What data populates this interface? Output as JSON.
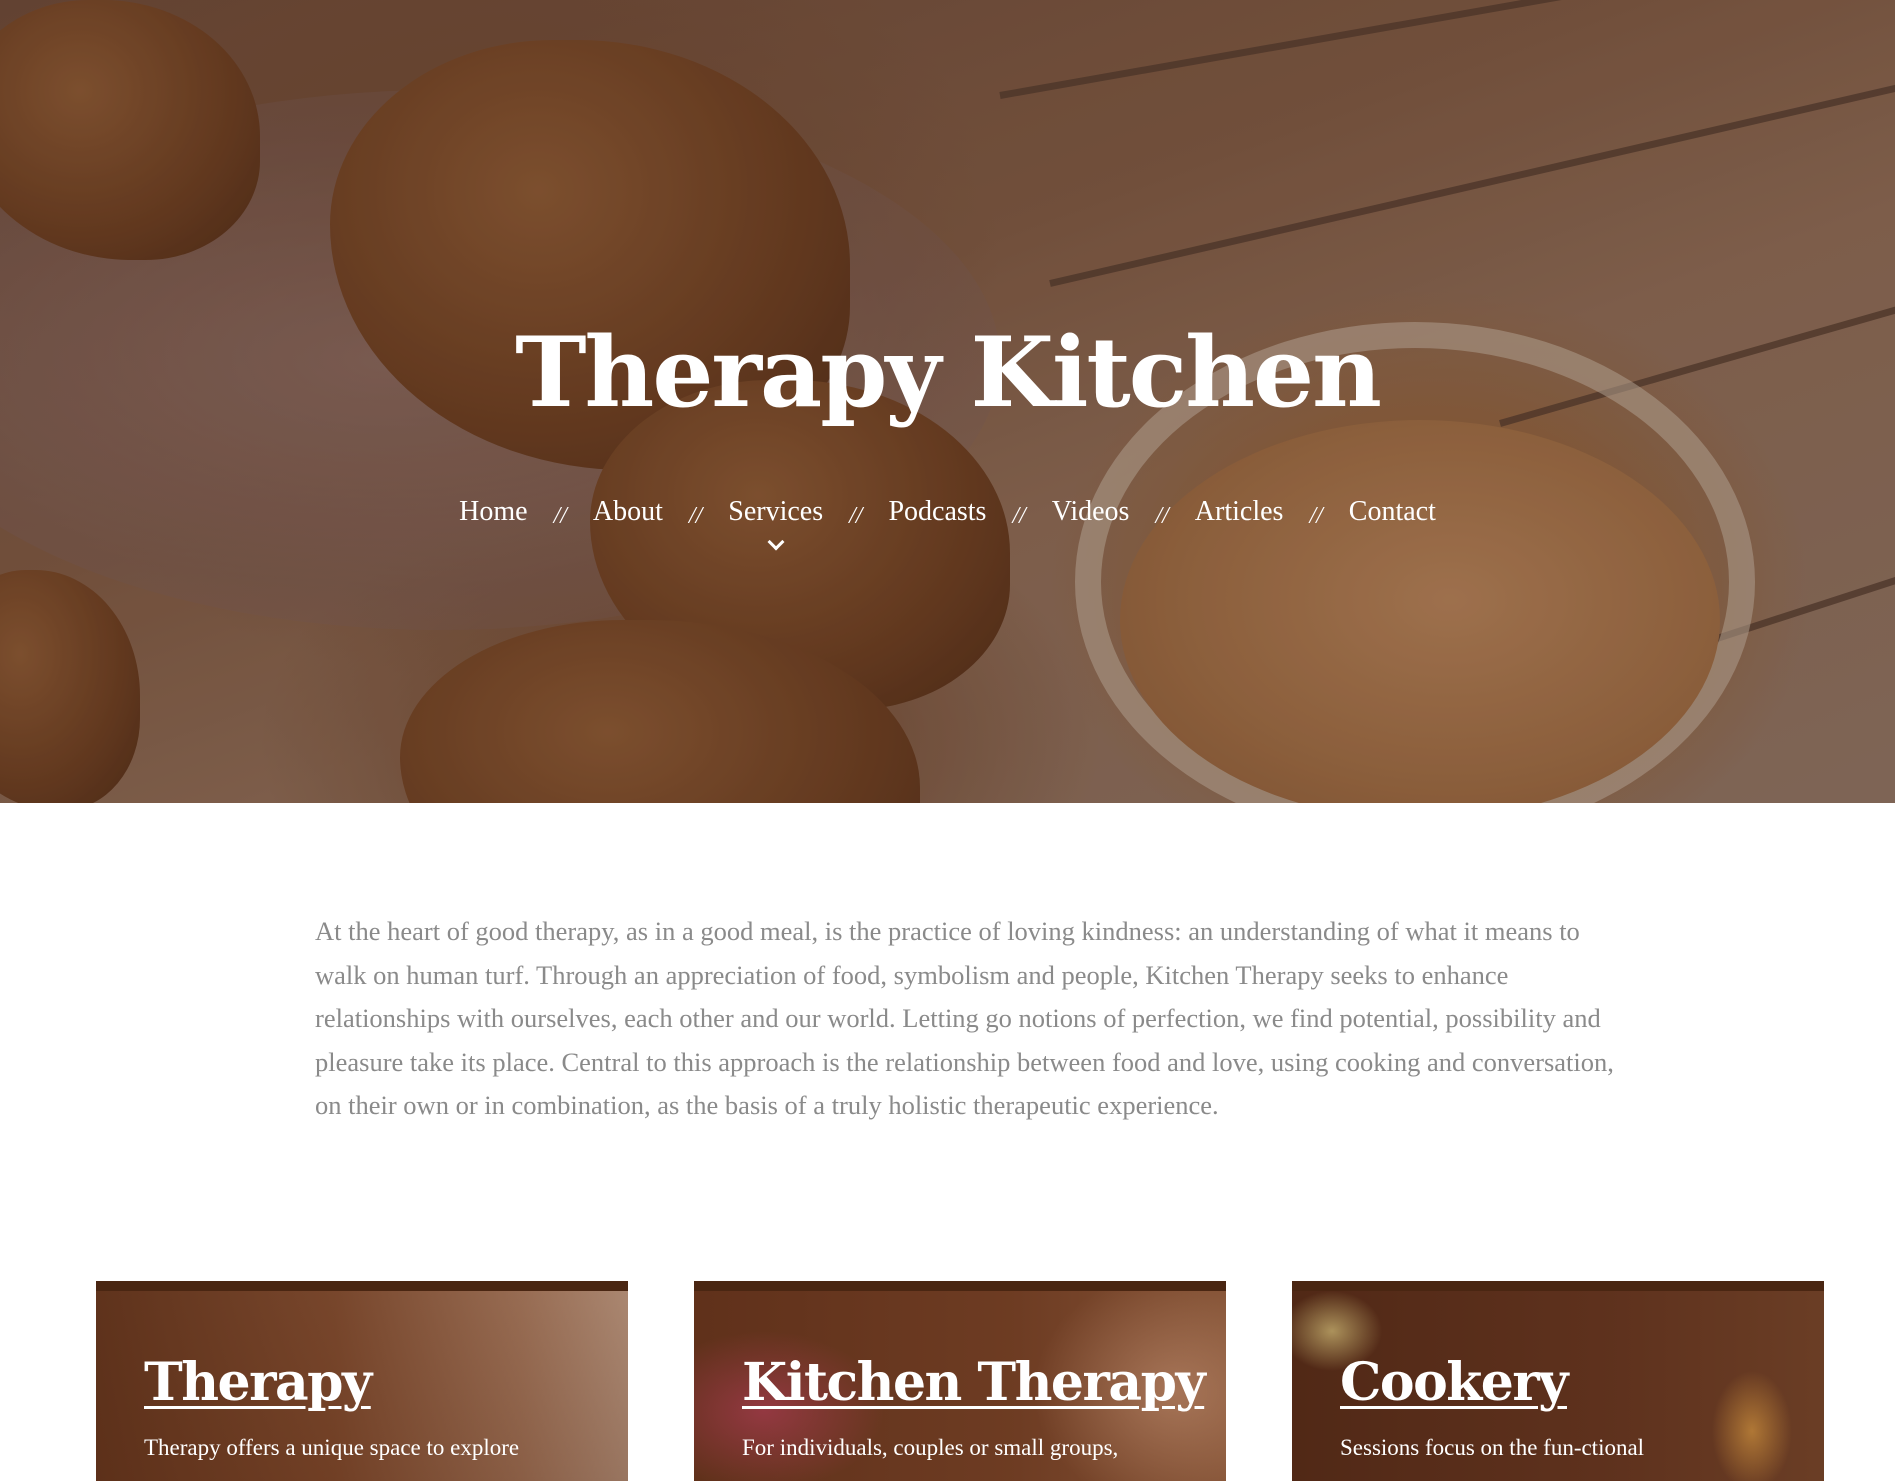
{
  "site": {
    "title": "Therapy Kitchen"
  },
  "nav": {
    "separator": "//",
    "items": [
      {
        "label": "Home"
      },
      {
        "label": "About"
      },
      {
        "label": "Services",
        "has_dropdown": true
      },
      {
        "label": "Podcasts"
      },
      {
        "label": "Videos"
      },
      {
        "label": "Articles"
      },
      {
        "label": "Contact"
      }
    ]
  },
  "intro": {
    "text": "At the heart of good therapy, as in a good meal, is the practice of loving kindness: an understanding of what it means to walk on human turf. Through an appreciation of food, symbolism and people, Kitchen Therapy seeks to enhance relationships with ourselves, each other and our world. Letting go notions of perfection, we find potential, possibility and pleasure take its place. Central to this approach is the relationship between food and love, using cooking and conversation, on their own or in combination, as the basis of a truly holistic therapeutic experience."
  },
  "cards": [
    {
      "title": "Therapy",
      "text": "Therapy offers a unique space to explore"
    },
    {
      "title": "Kitchen Therapy",
      "text": "For individuals, couples or small groups,"
    },
    {
      "title": "Cookery",
      "text": "Sessions focus on the fun-ctional"
    }
  ],
  "colors": {
    "hero_overlay": "#6b4b3a",
    "card_overlay": "#5a2e18",
    "intro_text": "#8a8a8a",
    "white": "#ffffff"
  },
  "icons": {
    "services_dropdown": "chevron-down-icon"
  }
}
